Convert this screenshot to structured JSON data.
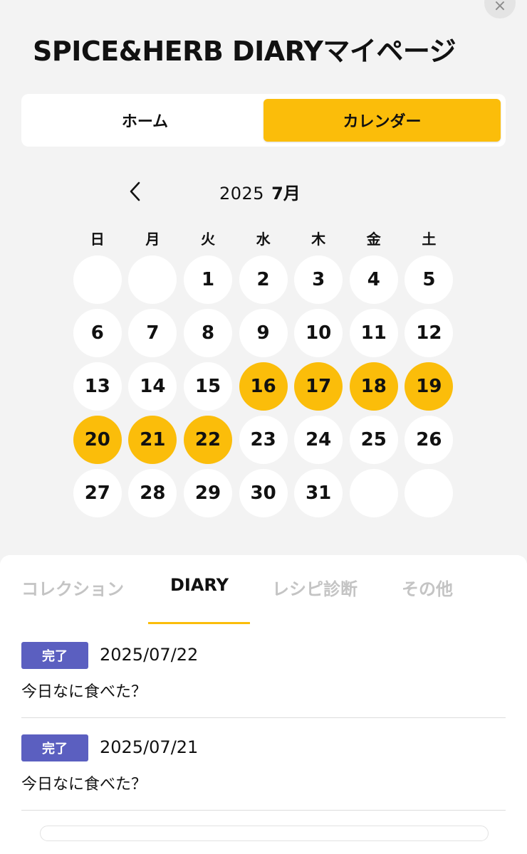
{
  "header": {
    "close_icon": "×",
    "title": "SPICE&HERB DIARYマイページ"
  },
  "segments": [
    {
      "label": "ホーム",
      "active": false
    },
    {
      "label": "カレンダー",
      "active": true
    }
  ],
  "calendar": {
    "year": "2025",
    "month": "7月",
    "prev_icon": "chevron-left-icon",
    "weekdays": [
      "日",
      "月",
      "火",
      "水",
      "木",
      "金",
      "土"
    ],
    "leading_blanks": 2,
    "trailing_blanks": 2,
    "days": [
      "1",
      "2",
      "3",
      "4",
      "5",
      "6",
      "7",
      "8",
      "9",
      "10",
      "11",
      "12",
      "13",
      "14",
      "15",
      "16",
      "17",
      "18",
      "19",
      "20",
      "21",
      "22",
      "23",
      "24",
      "25",
      "26",
      "27",
      "28",
      "29",
      "30",
      "31"
    ],
    "marked_days": [
      "16",
      "17",
      "18",
      "19",
      "20",
      "21",
      "22"
    ],
    "accent_color": "#fbbd0a"
  },
  "tabs": [
    {
      "label": "コレクション",
      "active": false
    },
    {
      "label": "DIARY",
      "active": true
    },
    {
      "label": "レシピ診断",
      "active": false
    },
    {
      "label": "その他",
      "active": false
    }
  ],
  "entries": [
    {
      "badge": "完了",
      "date": "2025/07/22",
      "text": "今日なに食べた？"
    },
    {
      "badge": "完了",
      "date": "2025/07/21",
      "text": "今日なに食べた？"
    }
  ],
  "colors": {
    "accent": "#fbbd0a",
    "badge": "#5b5fc0",
    "background": "#f3f3f3"
  }
}
